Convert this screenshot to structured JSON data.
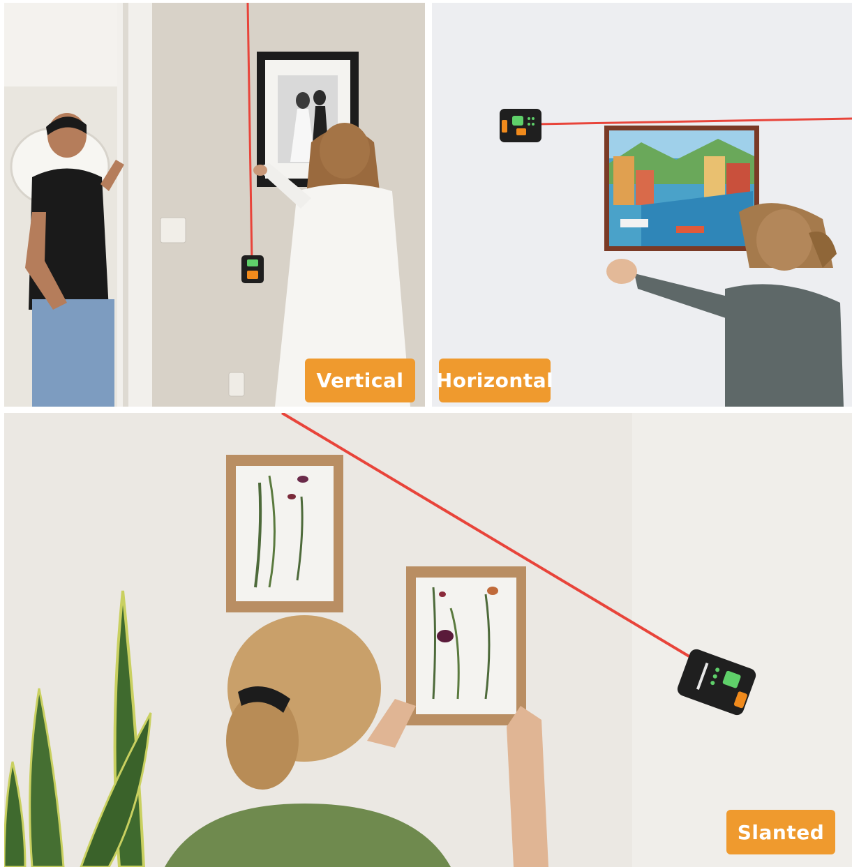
{
  "panels": {
    "vertical": {
      "label": "Vertical"
    },
    "horizontal": {
      "label": "Horizontal"
    },
    "slanted": {
      "label": "Slanted"
    }
  },
  "colors": {
    "laser": "#e8443a",
    "badge": "#ef9a2e",
    "badge_text": "#ffffff",
    "device_body": "#1f1f1f",
    "device_accent": "#f08a1c",
    "device_led": "#5fd06a"
  }
}
